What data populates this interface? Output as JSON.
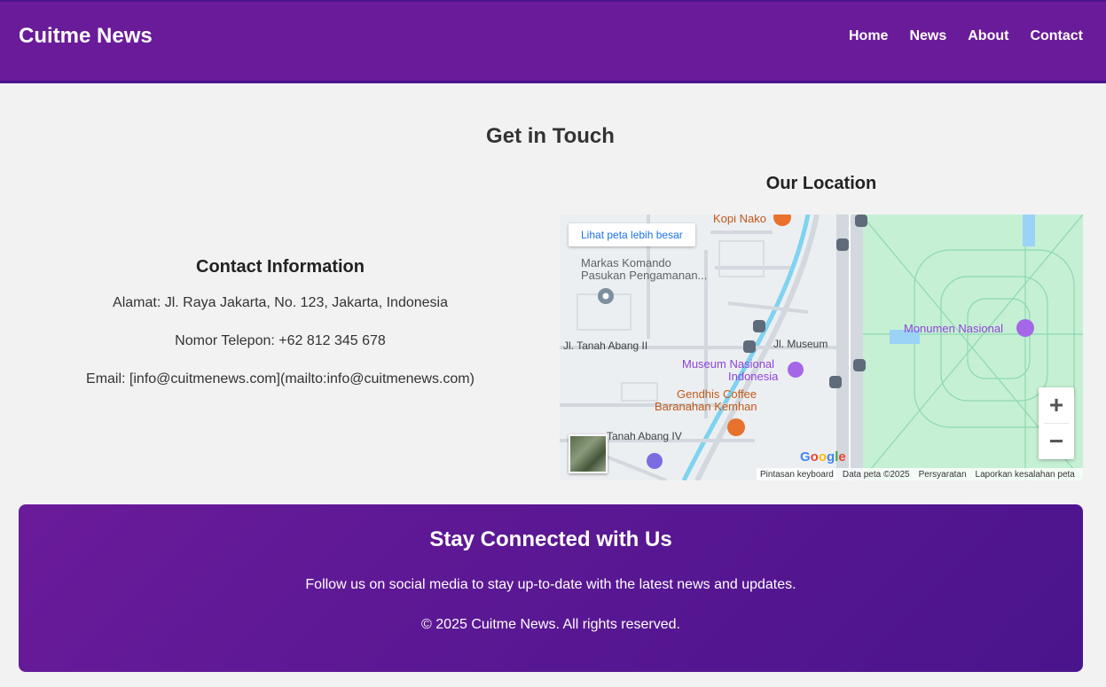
{
  "header": {
    "brand": "Cuitme News",
    "nav": [
      "Home",
      "News",
      "About",
      "Contact"
    ]
  },
  "page_title": "Get in Touch",
  "contact": {
    "title": "Contact Information",
    "address": "Alamat: Jl. Raya Jakarta, No. 123, Jakarta, Indonesia",
    "phone": "Nomor Telepon: +62 812 345 678",
    "email": "Email: [info@cuitmenews.com](mailto:info@cuitmenews.com)"
  },
  "location": {
    "title": "Our Location",
    "view_larger": "Lihat peta lebih besar",
    "labels": {
      "kopi_nako": "Kopi Nako",
      "markas1": "Markas Komando",
      "markas2": "Pasukan Pengamanan...",
      "tanah_abang_ii": "Jl. Tanah Abang II",
      "jl_museum": "Jl. Museum",
      "museum1": "Museum Nasional",
      "museum2": "Indonesia",
      "gendhis1": "Gendhis Coffee",
      "gendhis2": "Baranahan Kemhan",
      "monas": "Monumen Nasional",
      "tanah_abang_iv": "Tanah Abang IV"
    },
    "footer": [
      "Pintasan keyboard",
      "Data peta ©2025",
      "Persyaratan",
      "Laporkan kesalahan peta"
    ],
    "google": "Google"
  },
  "footer": {
    "title": "Stay Connected with Us",
    "text": "Follow us on social media to stay up-to-date with the latest news and updates.",
    "copyright": "© 2025 Cuitme News. All rights reserved."
  }
}
